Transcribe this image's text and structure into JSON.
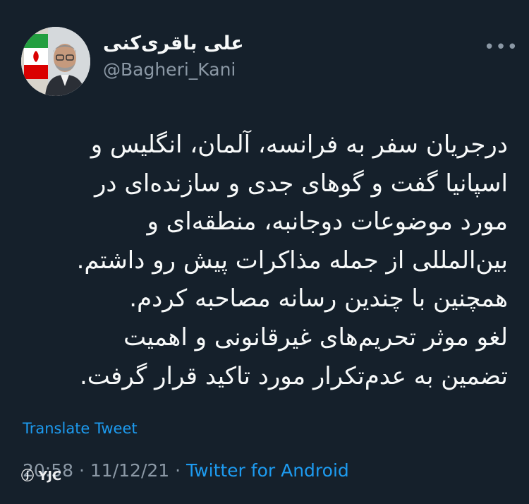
{
  "author": {
    "display_name": "علی باقری‌کنی",
    "handle": "@Bagheri_Kani",
    "avatar_icon": "profile-photo"
  },
  "more_icon": "more-horizontal-icon",
  "tweet": {
    "lines": [
      "درجریان سفر به فرانسه، آلمان، انگلیس و",
      "اسپانیا گفت و گوهای جدی و سازنده‌ای در",
      "مورد موضوعات دوجانبه، منطقه‌ای و",
      "بین‌المللی از جمله مذاکرات پیش رو داشتم.",
      "همچنین با چندین رسانه مصاحبه کردم.",
      "لغو موثر تحریم‌های غیرقانونی و اهمیت",
      "تضمین به عدم‌تکرار مورد تاکید قرار گرفت."
    ],
    "translate_label": "Translate Tweet",
    "time": "20:58",
    "separator": "·",
    "date": "11/12/21",
    "source": "Twitter for Android"
  },
  "watermark": {
    "logo_text": "YJC"
  },
  "colors": {
    "background": "#15202b",
    "text": "#f7f9f9",
    "secondary": "#8b98a5",
    "accent": "#1d9bf0"
  }
}
